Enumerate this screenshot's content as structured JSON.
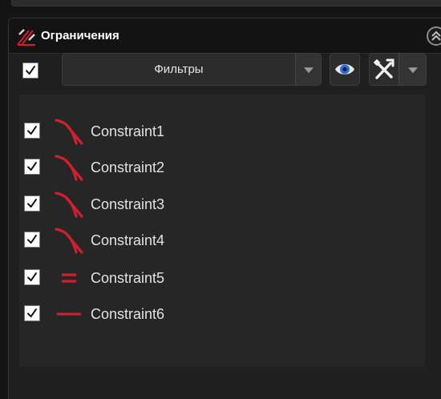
{
  "panel": {
    "title": "Ограничения",
    "icon": "sketch-constraint-icon"
  },
  "toolbar": {
    "select_all_checked": true,
    "filter_label": "Фильтры",
    "visibility_icon": "eye-icon",
    "tools_icon": "tools-icon"
  },
  "constraints": [
    {
      "label": "Constraint1",
      "checked": true,
      "icon": "tangent-constraint-icon"
    },
    {
      "label": "Constraint2",
      "checked": true,
      "icon": "tangent-constraint-icon"
    },
    {
      "label": "Constraint3",
      "checked": true,
      "icon": "tangent-constraint-icon"
    },
    {
      "label": "Constraint4",
      "checked": true,
      "icon": "tangent-constraint-icon"
    },
    {
      "label": "Constraint5",
      "checked": true,
      "icon": "equal-constraint-icon"
    },
    {
      "label": "Constraint6",
      "checked": true,
      "icon": "horizontal-constraint-icon"
    }
  ],
  "colors": {
    "accent_red": "#d21f2b",
    "panel_bg": "#1f1f1f",
    "header_bg": "#131313",
    "eye_blue": "#2f6fd6"
  }
}
